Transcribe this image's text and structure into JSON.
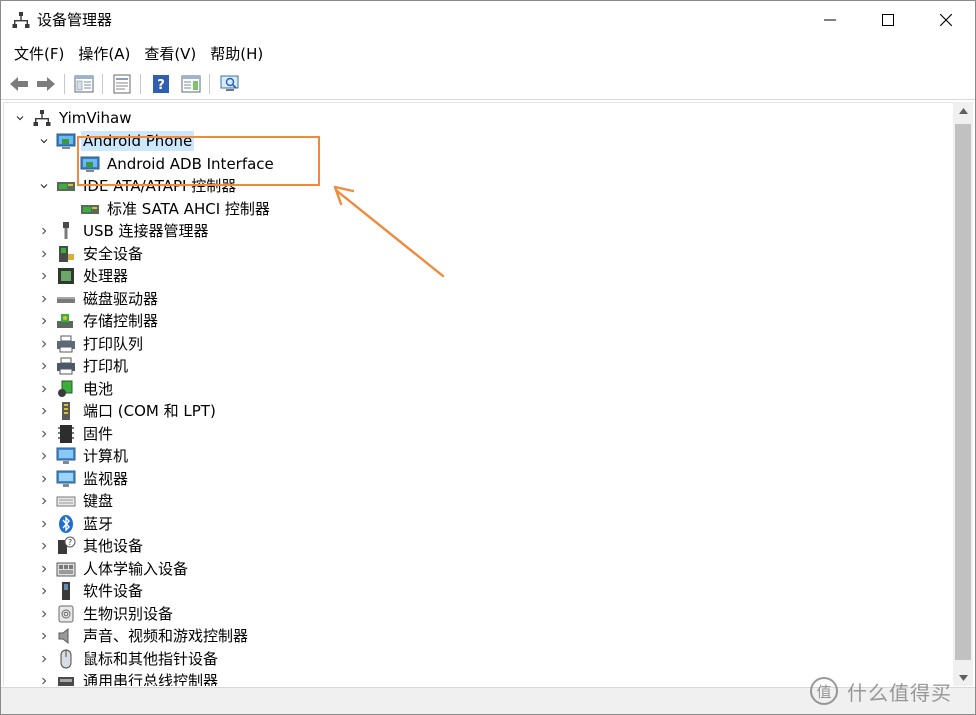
{
  "window": {
    "title": "设备管理器"
  },
  "menu": [
    "文件(F)",
    "操作(A)",
    "查看(V)",
    "帮助(H)"
  ],
  "tree": {
    "root": "YimVihaw",
    "items": [
      {
        "label": "Android Phone",
        "icon": "phone-device-icon",
        "expanded": true,
        "selected": true,
        "children": [
          "Android ADB Interface"
        ]
      },
      {
        "label": "IDE ATA/ATAPI 控制器",
        "icon": "ide-controller-icon",
        "expanded": true,
        "children": [
          "标准 SATA AHCI 控制器"
        ]
      },
      {
        "label": "USB 连接器管理器",
        "icon": "usb-connector-icon"
      },
      {
        "label": "安全设备",
        "icon": "security-device-icon"
      },
      {
        "label": "处理器",
        "icon": "processor-icon"
      },
      {
        "label": "磁盘驱动器",
        "icon": "disk-drive-icon"
      },
      {
        "label": "存储控制器",
        "icon": "storage-controller-icon"
      },
      {
        "label": "打印队列",
        "icon": "print-queue-icon"
      },
      {
        "label": "打印机",
        "icon": "printer-icon"
      },
      {
        "label": "电池",
        "icon": "battery-icon"
      },
      {
        "label": "端口 (COM 和 LPT)",
        "icon": "port-icon"
      },
      {
        "label": "固件",
        "icon": "firmware-icon"
      },
      {
        "label": "计算机",
        "icon": "computer-icon"
      },
      {
        "label": "监视器",
        "icon": "monitor-icon"
      },
      {
        "label": "键盘",
        "icon": "keyboard-icon"
      },
      {
        "label": "蓝牙",
        "icon": "bluetooth-icon"
      },
      {
        "label": "其他设备",
        "icon": "other-device-icon"
      },
      {
        "label": "人体学输入设备",
        "icon": "hid-icon"
      },
      {
        "label": "软件设备",
        "icon": "software-device-icon"
      },
      {
        "label": "生物识别设备",
        "icon": "biometric-icon"
      },
      {
        "label": "声音、视频和游戏控制器",
        "icon": "sound-icon"
      },
      {
        "label": "鼠标和其他指针设备",
        "icon": "mouse-icon"
      },
      {
        "label": "通用串行总线控制器",
        "icon": "usb-controller-icon"
      }
    ]
  },
  "colors": {
    "selection": "#cce8ff",
    "annotation": "#f08a3c",
    "scroll_thumb": "#c1c1c1"
  },
  "watermark": {
    "logo_char": "值",
    "text": "什么值得买"
  }
}
